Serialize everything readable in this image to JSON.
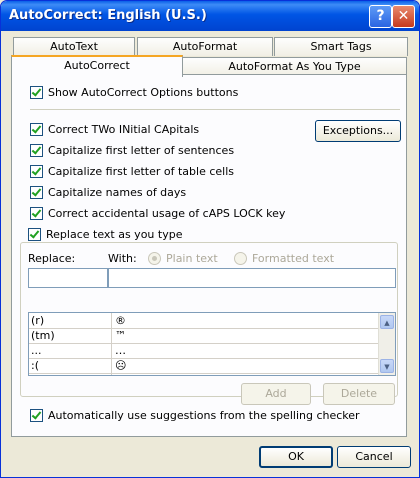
{
  "window": {
    "title": "AutoCorrect: English (U.S.)",
    "help_glyph": "?",
    "close_glyph": "✕"
  },
  "tabs": {
    "back": [
      {
        "label": "AutoText"
      },
      {
        "label": "AutoFormat"
      },
      {
        "label": "Smart Tags"
      }
    ],
    "front": [
      {
        "label": "AutoCorrect",
        "active": true
      },
      {
        "label": "AutoFormat As You Type"
      }
    ]
  },
  "options": {
    "show_buttons": "Show AutoCorrect Options buttons",
    "two_initial": "Correct TWo INitial CApitals",
    "sentences": "Capitalize first letter of sentences",
    "table_cells": "Capitalize first letter of table cells",
    "days": "Capitalize names of days",
    "caps_lock": "Correct accidental usage of cAPS LOCK key",
    "replace_typing": "Replace text as you type",
    "spelling": "Automatically use suggestions from the spelling checker"
  },
  "exceptions_button": "Exceptions...",
  "replace": {
    "replace_label": "Replace:",
    "with_label": "With:",
    "plain_text": "Plain text",
    "formatted_text": "Formatted text",
    "replace_value": "",
    "with_value": ""
  },
  "entries": [
    {
      "from": "(r)",
      "to": "®"
    },
    {
      "from": "(tm)",
      "to": "™"
    },
    {
      "from": "...",
      "to": "…"
    },
    {
      "from": ":(",
      "to": "☹"
    }
  ],
  "buttons": {
    "add": "Add",
    "delete": "Delete",
    "ok": "OK",
    "cancel": "Cancel"
  },
  "scroll": {
    "up": "▲",
    "down": "▼"
  }
}
